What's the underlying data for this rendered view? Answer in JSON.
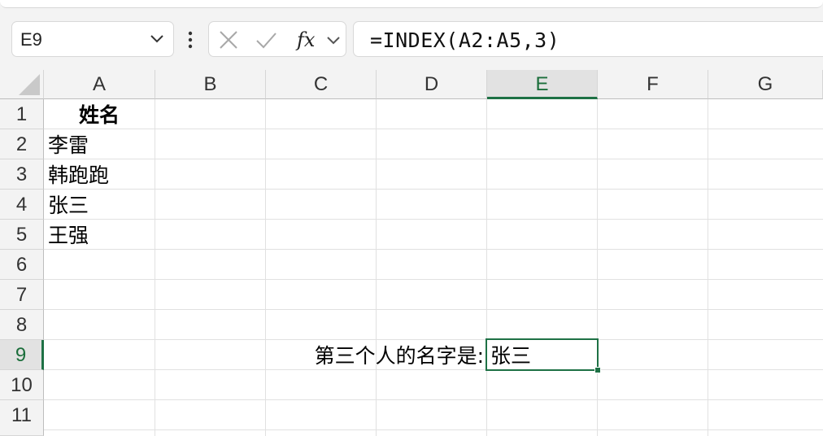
{
  "name_box": {
    "value": "E9"
  },
  "formula_bar": {
    "formula": "=INDEX(A2:A5,3)",
    "icons": [
      "cancel-x-icon",
      "confirm-check-icon",
      "fx-icon",
      "chevron-down-icon"
    ]
  },
  "columns": [
    "A",
    "B",
    "C",
    "D",
    "E",
    "F",
    "G"
  ],
  "selected_column": "E",
  "rows": [
    "1",
    "2",
    "3",
    "4",
    "5",
    "6",
    "7",
    "8",
    "9",
    "10",
    "11"
  ],
  "selected_row": "9",
  "cells": {
    "A1": "姓名",
    "A2": "李雷",
    "A3": "韩跑跑",
    "A4": "张三",
    "A5": "王强",
    "D9": "第三个人的名字是:",
    "E9": "张三"
  },
  "colors": {
    "selection": "#1e7145",
    "header_bg": "#f3f3f3",
    "grid_line": "#e1e1e1"
  }
}
